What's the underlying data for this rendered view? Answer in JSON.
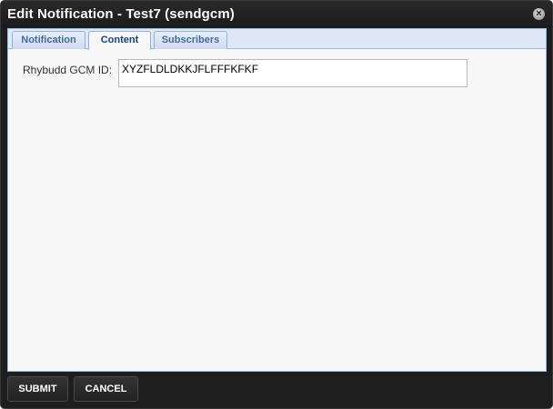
{
  "dialog": {
    "title": "Edit Notification - Test7 (sendgcm)",
    "close_glyph": "×"
  },
  "tabs": [
    {
      "label": "Notification",
      "active": false
    },
    {
      "label": "Content",
      "active": true
    },
    {
      "label": "Subscribers",
      "active": false
    }
  ],
  "form": {
    "gcm_label": "Rhybudd GCM ID:",
    "gcm_value": "XYZFLDLDKKJFLFFFKFKF"
  },
  "footer": {
    "submit_label": "SUBMIT",
    "cancel_label": "CANCEL"
  },
  "colors": {
    "dialog_bg": "#1e1e1e",
    "panel_bg": "#f7f7f7",
    "tab_text": "#15428b",
    "tab_border": "#99bbe8"
  },
  "icons": {
    "close": "close-icon"
  }
}
